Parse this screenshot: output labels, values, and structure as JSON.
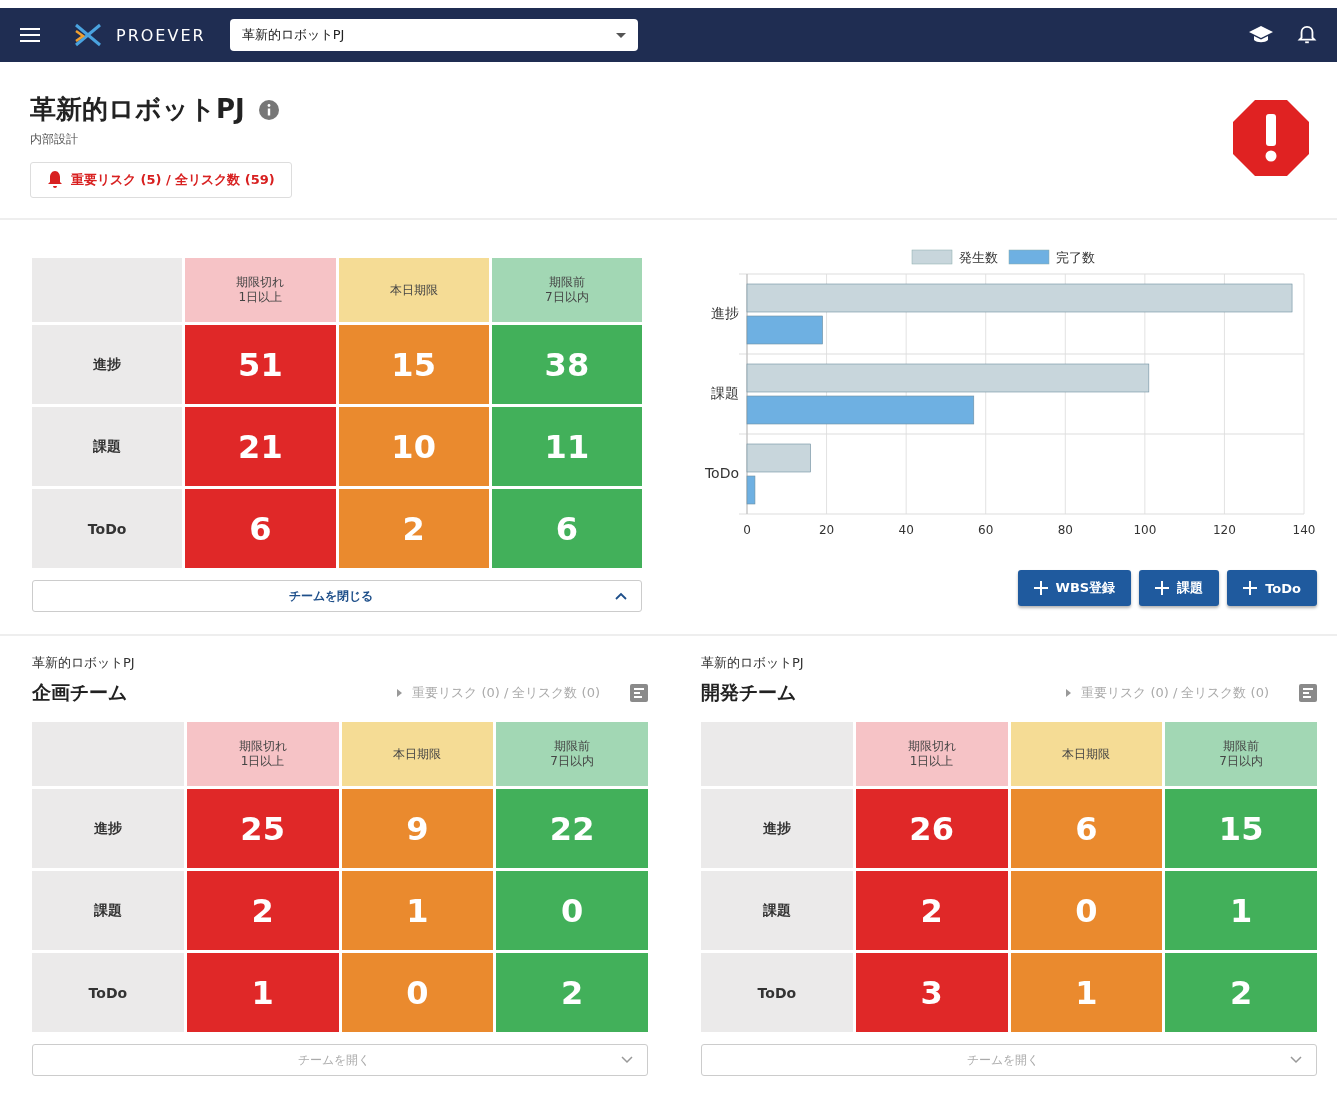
{
  "header": {
    "brand": "PROEVER",
    "project_select": "革新的ロボットPJ"
  },
  "project": {
    "title": "革新的ロボットPJ",
    "phase": "内部設計",
    "risk_button": "重要リスク (5) / 全リスク数 (59)",
    "alert": true
  },
  "summary": {
    "matrix": {
      "columns": [
        {
          "kind": "overdue",
          "label": "期限切れ\n1日以上"
        },
        {
          "kind": "today",
          "label": "本日期限"
        },
        {
          "kind": "upcoming",
          "label": "期限前\n7日以内"
        }
      ],
      "rows": [
        {
          "label": "進捗",
          "values": [
            "51",
            "15",
            "38"
          ]
        },
        {
          "label": "課題",
          "values": [
            "21",
            "10",
            "11"
          ]
        },
        {
          "label": "ToDo",
          "values": [
            "6",
            "2",
            "6"
          ]
        }
      ]
    },
    "toggle": {
      "label": "チームを閉じる",
      "expanded": true
    },
    "chart_data": {
      "type": "bar",
      "orientation": "horizontal",
      "categories": [
        "進捗",
        "課題",
        "ToDo"
      ],
      "series": [
        {
          "name": "発生数",
          "color": "#c8d6dc",
          "values": [
            137,
            101,
            16
          ]
        },
        {
          "name": "完了数",
          "color": "#6eb0e2",
          "values": [
            19,
            57,
            2
          ]
        }
      ],
      "xlim": [
        0,
        140
      ],
      "xticks": [
        0,
        20,
        40,
        60,
        80,
        100,
        120,
        140
      ],
      "grid": true,
      "legend": true
    },
    "actions": [
      "WBS登録",
      "課題",
      "ToDo"
    ]
  },
  "teams": [
    {
      "project": "革新的ロボットPJ",
      "name": "企画チーム",
      "risk_link": "重要リスク (0) / 全リスク数 (0)",
      "matrix": {
        "columns": [
          {
            "kind": "overdue",
            "label": "期限切れ\n1日以上"
          },
          {
            "kind": "today",
            "label": "本日期限"
          },
          {
            "kind": "upcoming",
            "label": "期限前\n7日以内"
          }
        ],
        "rows": [
          {
            "label": "進捗",
            "values": [
              "25",
              "9",
              "22"
            ]
          },
          {
            "label": "課題",
            "values": [
              "2",
              "1",
              "0"
            ]
          },
          {
            "label": "ToDo",
            "values": [
              "1",
              "0",
              "2"
            ]
          }
        ]
      },
      "toggle": {
        "label": "チームを開く",
        "expanded": false
      }
    },
    {
      "project": "革新的ロボットPJ",
      "name": "開発チーム",
      "risk_link": "重要リスク (0) / 全リスク数 (0)",
      "matrix": {
        "columns": [
          {
            "kind": "overdue",
            "label": "期限切れ\n1日以上"
          },
          {
            "kind": "today",
            "label": "本日期限"
          },
          {
            "kind": "upcoming",
            "label": "期限前\n7日以内"
          }
        ],
        "rows": [
          {
            "label": "進捗",
            "values": [
              "26",
              "6",
              "15"
            ]
          },
          {
            "label": "課題",
            "values": [
              "2",
              "0",
              "1"
            ]
          },
          {
            "label": "ToDo",
            "values": [
              "3",
              "1",
              "2"
            ]
          }
        ]
      },
      "toggle": {
        "label": "チームを開く",
        "expanded": false
      }
    }
  ]
}
